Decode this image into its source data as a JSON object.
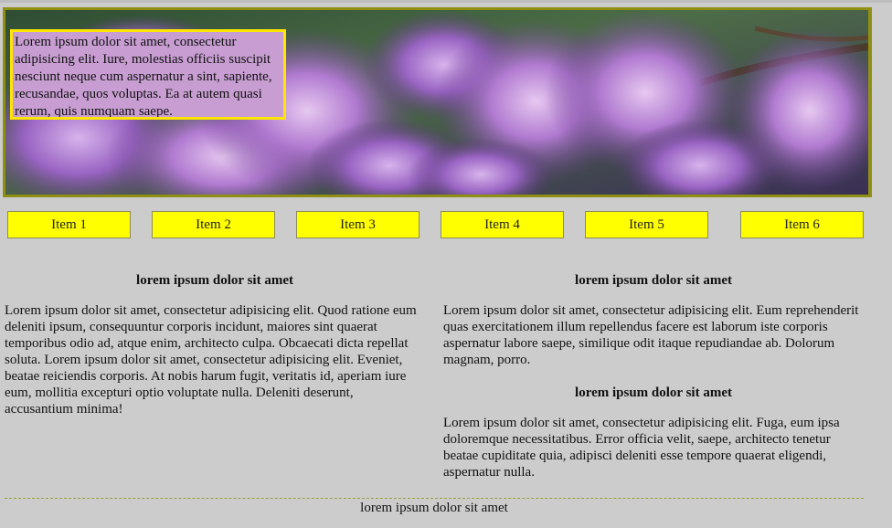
{
  "hero": {
    "caption": "Lorem ipsum dolor sit amet, consectetur adipisicing elit. Iure, molestias officiis suscipit nesciunt neque cum aspernatur a sint, sapiente, recusandae, quos voluptas. Ea at autem quasi rerum, quis numquam saepe.",
    "image_subject": "lilac flowers photo",
    "colors": {
      "border": "#8f8f14",
      "caption_bg": "#c89ed2",
      "caption_border": "#ffe600"
    }
  },
  "nav": {
    "items": [
      {
        "label": "Item 1"
      },
      {
        "label": "Item 2"
      },
      {
        "label": "Item 3"
      },
      {
        "label": "Item 4"
      },
      {
        "label": "Item 5"
      },
      {
        "label": "Item 6"
      }
    ],
    "colors": {
      "bg": "#ffff00",
      "border": "#8c8c5a"
    }
  },
  "left_column": {
    "heading": "lorem ipsum dolor sit amet",
    "paragraph": "Lorem ipsum dolor sit amet, consectetur adipisicing elit. Quod ratione eum deleniti ipsum, consequuntur corporis incidunt, maiores sint quaerat temporibus odio ad, atque enim, architecto culpa. Obcaecati dicta repellat soluta. Lorem ipsum dolor sit amet, consectetur adipisicing elit. Eveniet, beatae reiciendis corporis. At nobis harum fugit, veritatis id, aperiam iure eum, mollitia excepturi optio voluptate nulla. Deleniti deserunt, accusantium minima!"
  },
  "right_column": {
    "heading_1": "lorem ipsum dolor sit amet",
    "paragraph_1": "Lorem ipsum dolor sit amet, consectetur adipisicing elit. Eum reprehenderit quas exercitationem illum repellendus facere est laborum iste corporis aspernatur labore saepe, similique odit itaque repudiandae ab. Dolorum magnam, porro.",
    "heading_2": "lorem ipsum dolor sit amet",
    "paragraph_2": "Lorem ipsum dolor sit amet, consectetur adipisicing elit. Fuga, eum ipsa doloremque necessitatibus. Error officia velit, saepe, architecto tenetur beatae cupiditate quia, adipisci deleniti esse tempore quaerat eligendi, aspernatur nulla."
  },
  "footer": {
    "text": "lorem ipsum dolor sit amet"
  },
  "page": {
    "background": "#cccccc"
  }
}
